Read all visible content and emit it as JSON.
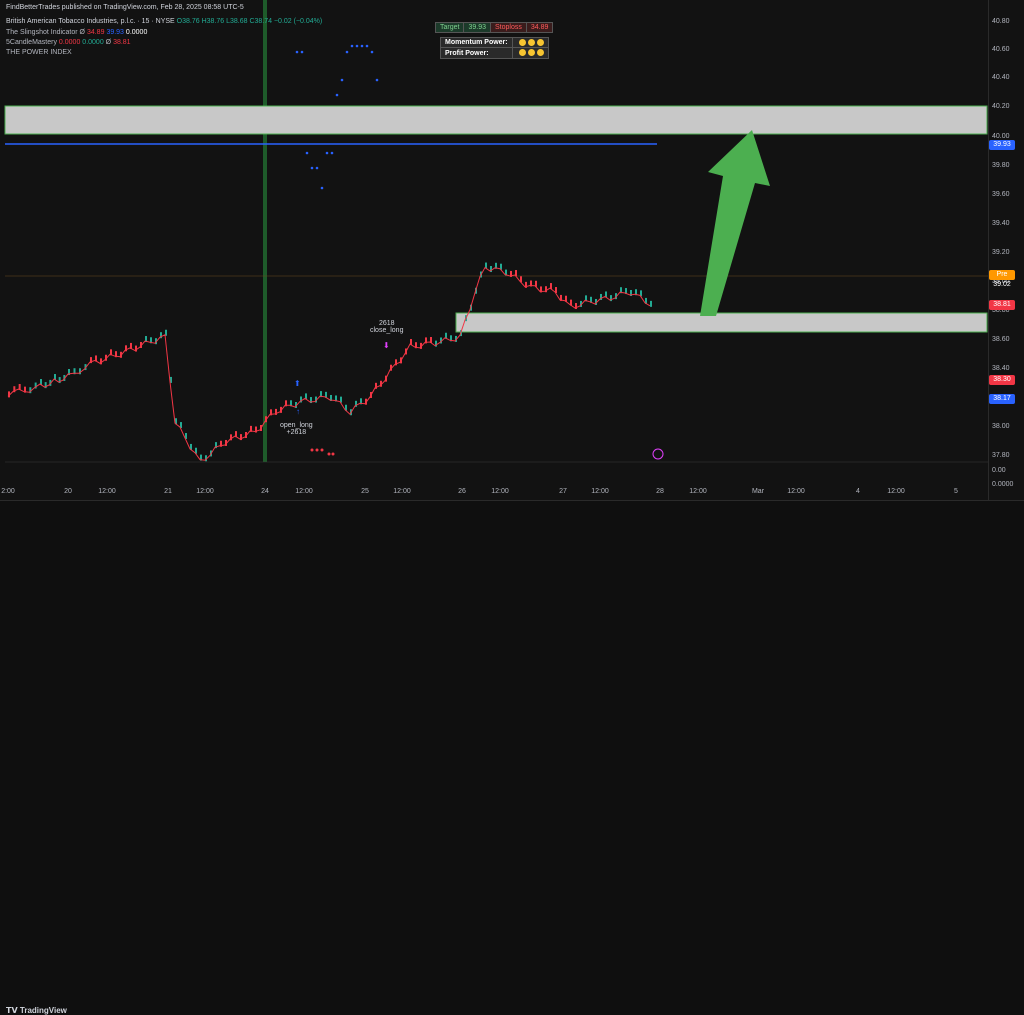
{
  "header": {
    "publisher": "FindBetterTrades published on TradingView.com, Feb 28, 2025 08:58 UTC-5",
    "symbol": "British American Tobacco Industries, p.l.c. · 15 · NYSE",
    "ohlc": "O38.76 H38.76 L38.68 C38.74 −0.02 (−0.04%)",
    "indicators": [
      {
        "name": "The Slingshot Indicator",
        "values": [
          "34.89",
          "39.93",
          "0.0000"
        ]
      },
      {
        "name": "5CandleMastery",
        "values": [
          "0.0000",
          "0.0000",
          "38.81"
        ]
      },
      {
        "name": "THE POWER INDEX",
        "values": []
      }
    ]
  },
  "target_table": {
    "target_label": "Target",
    "target_value": "39.93",
    "stoploss_label": "Stoploss",
    "stoploss_value": "34.89"
  },
  "power_table": {
    "rows": [
      {
        "label": "Momentum Power:",
        "dots": 3
      },
      {
        "label": "Profit Power:",
        "dots": 3
      }
    ]
  },
  "price_axis": {
    "ticks": [
      "40.80",
      "40.60",
      "40.40",
      "40.20",
      "40.00",
      "39.80",
      "39.60",
      "39.40",
      "39.20",
      "39.00",
      "38.80",
      "38.60",
      "38.40",
      "38.20",
      "38.00",
      "37.80",
      "0.00",
      "0.0000"
    ],
    "tags": [
      {
        "label": "39.93",
        "color": "#2962ff"
      },
      {
        "label": "Pre 39.02",
        "color": "#ff9800"
      },
      {
        "label": "38.81",
        "color": "#f23645"
      },
      {
        "label": "38.30",
        "color": "#f23645"
      },
      {
        "label": "38.17",
        "color": "#2962ff"
      }
    ]
  },
  "time_axis": {
    "labels": [
      "2:00",
      "20",
      "12:00",
      "21",
      "12:00",
      "24",
      "12:00",
      "25",
      "12:00",
      "26",
      "12:00",
      "27",
      "12:00",
      "28",
      "12:00",
      "Mar",
      "12:00",
      "4",
      "12:00",
      "5"
    ]
  },
  "annotations": {
    "close_long": "2618\nclose_long",
    "open_long": "open_long\n+2618"
  },
  "footer": {
    "logo": "TradingView"
  },
  "colors": {
    "bg": "#121212",
    "candle_up": "#22ab94",
    "candle_down": "#f23645",
    "zone_fill": "#c8c8c8",
    "zone_border": "#4caf50",
    "arrow": "#4caf50",
    "target_line": "#2962ff"
  }
}
